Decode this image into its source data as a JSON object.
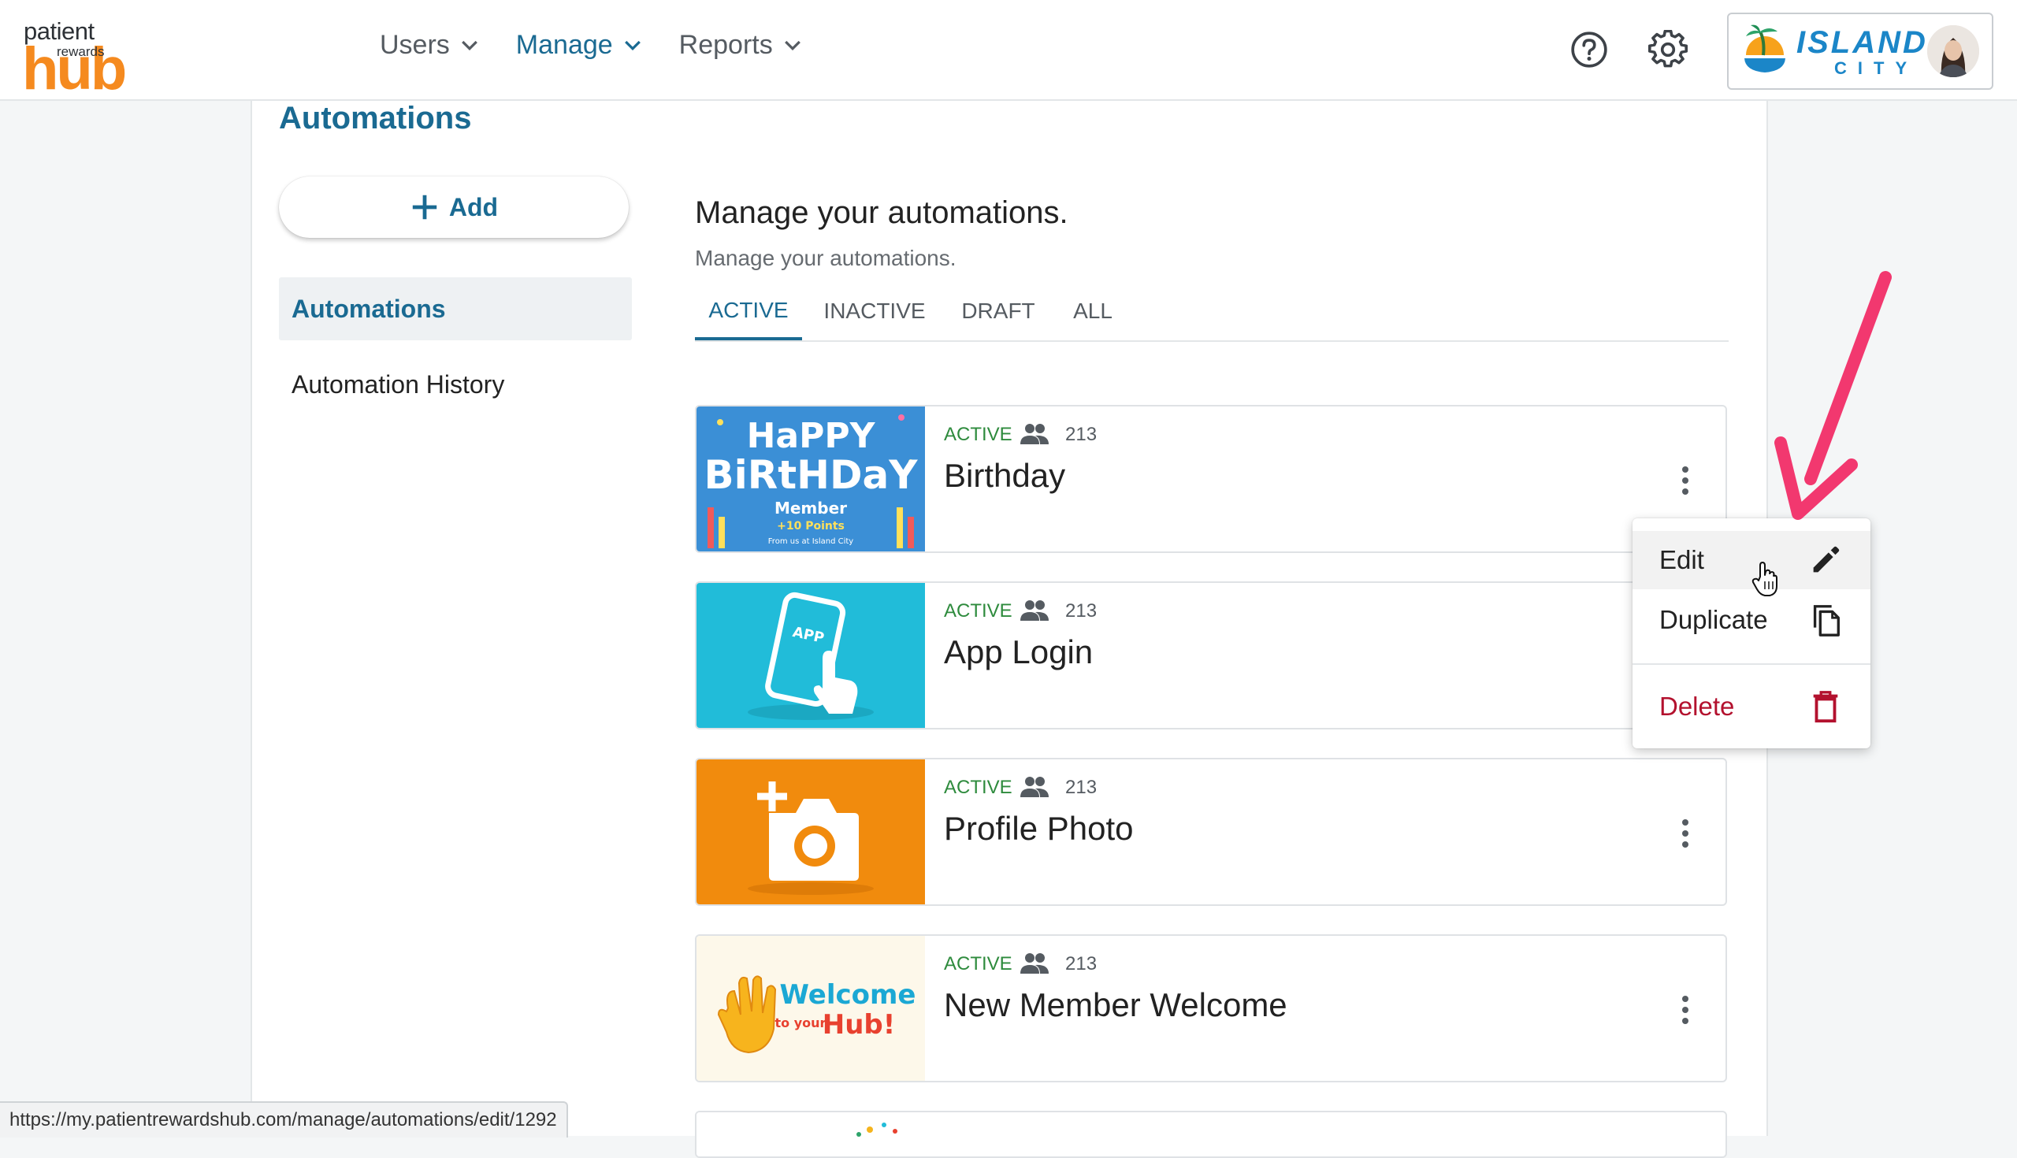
{
  "logo": {
    "line1": "patient",
    "line2": "rewards",
    "line3": "hub"
  },
  "nav": [
    {
      "label": "Users"
    },
    {
      "label": "Manage"
    },
    {
      "label": "Reports"
    }
  ],
  "brand": {
    "line1": "ISLAND",
    "line2": "CITY"
  },
  "page": {
    "title": "Automations",
    "add_label": "Add",
    "sidebar": [
      {
        "label": "Automations"
      },
      {
        "label": "Automation History"
      }
    ],
    "section_title": "Manage your automations.",
    "section_subtitle": "Manage your automations."
  },
  "tabs": [
    {
      "label": "ACTIVE"
    },
    {
      "label": "INACTIVE"
    },
    {
      "label": "DRAFT"
    },
    {
      "label": "ALL"
    }
  ],
  "automations": [
    {
      "name": "Birthday",
      "status": "ACTIVE",
      "count": "213",
      "thumb": {
        "t1": "HaPPY",
        "t2": "BiRtHDaY",
        "t3": "Member",
        "t4": "+10 Points",
        "t5": "From us at Island City"
      }
    },
    {
      "name": "App Login",
      "status": "ACTIVE",
      "count": "213",
      "thumb": {
        "t1": "APP"
      }
    },
    {
      "name": "Profile Photo",
      "status": "ACTIVE",
      "count": "213"
    },
    {
      "name": "New Member Welcome",
      "status": "ACTIVE",
      "count": "213",
      "thumb": {
        "t1": "Welcome",
        "t2": "to your",
        "t3": "Hub!"
      }
    }
  ],
  "menu": [
    {
      "label": "Edit",
      "icon": "pencil-icon"
    },
    {
      "label": "Duplicate",
      "icon": "copy-icon"
    },
    {
      "label": "Delete",
      "icon": "trash-icon"
    }
  ],
  "status_url": "https://my.patientrewardshub.com/manage/automations/edit/1292",
  "colors": {
    "accent": "#1a6a92",
    "active_green": "#2e8b3d",
    "danger": "#b3112e",
    "brand_orange": "#f58a1f",
    "annotation_arrow": "#f2386f"
  }
}
